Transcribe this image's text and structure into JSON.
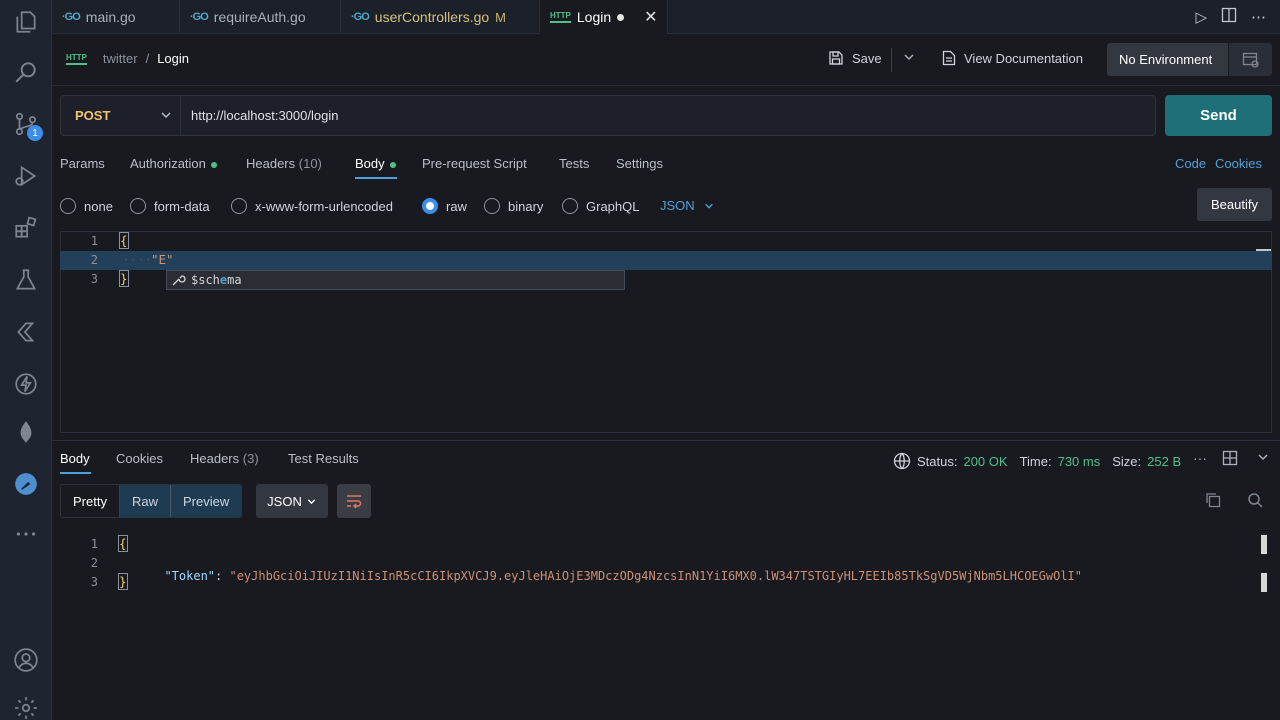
{
  "colors": {
    "accent": "#4ea0d8",
    "send": "#1e6f78",
    "method_post": "#f0c36c",
    "ok": "#4fc08d",
    "badge": "#3b8eea"
  },
  "activity_bar": {
    "source_control_badge": "1"
  },
  "tabs": [
    {
      "label": "main.go",
      "icon": "go"
    },
    {
      "label": "requireAuth.go",
      "icon": "go"
    },
    {
      "label": "userControllers.go",
      "icon": "go",
      "status": "M"
    },
    {
      "label": "Login",
      "icon": "HTTP",
      "active": true
    }
  ],
  "header": {
    "workspace": "twitter",
    "separator": "/",
    "request_name": "Login",
    "save_label": "Save",
    "view_docs_label": "View Documentation",
    "environment": "No Environment"
  },
  "request": {
    "method": "POST",
    "url": "http://localhost:3000/login",
    "send_label": "Send",
    "tabs": {
      "params": "Params",
      "authorization": "Authorization",
      "headers": "Headers",
      "headers_count": "(10)",
      "body": "Body",
      "prerequest": "Pre-request Script",
      "tests": "Tests",
      "settings": "Settings"
    },
    "code_link": "Code",
    "cookies_link": "Cookies",
    "body_types": {
      "none": "none",
      "form_data": "form-data",
      "urlencoded": "x-www-form-urlencoded",
      "raw": "raw",
      "binary": "binary",
      "graphql": "GraphQL",
      "selected": "raw"
    },
    "language": "JSON",
    "beautify_label": "Beautify",
    "editor": {
      "line_numbers": [
        "1",
        "2",
        "3"
      ],
      "line1": "{",
      "line2_indent": "····",
      "line2_text": "\"E\"",
      "line3": "}",
      "suggestion_prefix": "$sch",
      "suggestion_match": "e",
      "suggestion_suffix": "ma"
    }
  },
  "response": {
    "tabs": {
      "body": "Body",
      "cookies": "Cookies",
      "headers": "Headers",
      "headers_count": "(3)",
      "test_results": "Test Results"
    },
    "status_label": "Status:",
    "status_value": "200 OK",
    "time_label": "Time:",
    "time_value": "730 ms",
    "size_label": "Size:",
    "size_value": "252 B",
    "view_modes": {
      "pretty": "Pretty",
      "raw": "Raw",
      "preview": "Preview"
    },
    "format": "JSON",
    "body": {
      "line_numbers": [
        "1",
        "2",
        "3"
      ],
      "open": "{",
      "key": "\"Token\"",
      "colon": ": ",
      "value": "\"eyJhbGciOiJIUzI1NiIsInR5cCI6IkpXVCJ9.eyJleHAiOjE3MDczODg4NzcsInN1YiI6MX0.lW347TSTGIyHL7EEIb85TkSgVD5WjNbm5LHCOEGwOlI\"",
      "close": "}"
    }
  }
}
